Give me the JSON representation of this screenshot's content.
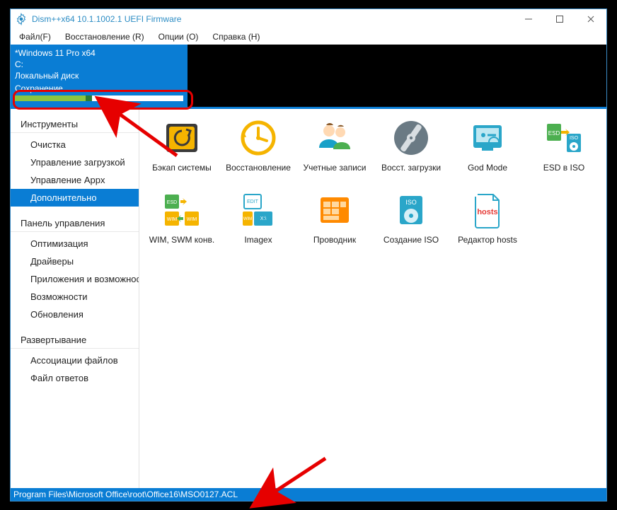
{
  "title": "Dism++x64 10.1.1002.1 UEFI Firmware",
  "menu": {
    "file": "Файл(F)",
    "recovery": "Восстановление (R)",
    "options": "Опции (O)",
    "help": "Справка (H)"
  },
  "osinfo": {
    "line1": "*Windows 11 Pro x64",
    "line2": "C:",
    "line3": "Локальный диск",
    "progress_label": "Сохранение"
  },
  "sidebar": {
    "section1": "Инструменты",
    "items1": [
      "Очистка",
      "Управление загрузкой",
      "Управление Appx",
      "Дополнительно"
    ],
    "selected1": 3,
    "section2": "Панель управления",
    "items2": [
      "Оптимизация",
      "Драйверы",
      "Приложения и возможности",
      "Возможности",
      "Обновления"
    ],
    "section3": "Развертывание",
    "items3": [
      "Ассоциации файлов",
      "Файл ответов"
    ]
  },
  "tools": [
    {
      "name": "backup-system",
      "label": "Бэкап системы"
    },
    {
      "name": "restore",
      "label": "Восстановление"
    },
    {
      "name": "user-accounts",
      "label": "Учетные записи"
    },
    {
      "name": "boot-recover",
      "label": "Восст. загрузки"
    },
    {
      "name": "god-mode",
      "label": "God Mode"
    },
    {
      "name": "esd-to-iso",
      "label": "ESD в ISO"
    },
    {
      "name": "wim-swm-conv",
      "label": "WIM, SWM конв."
    },
    {
      "name": "imagex",
      "label": "Imagex"
    },
    {
      "name": "explorer",
      "label": "Проводник"
    },
    {
      "name": "create-iso",
      "label": "Создание ISO"
    },
    {
      "name": "hosts-editor",
      "label": "Редактор hosts"
    }
  ],
  "status": "Program Files\\Microsoft Office\\root\\Office16\\MSO0127.ACL"
}
